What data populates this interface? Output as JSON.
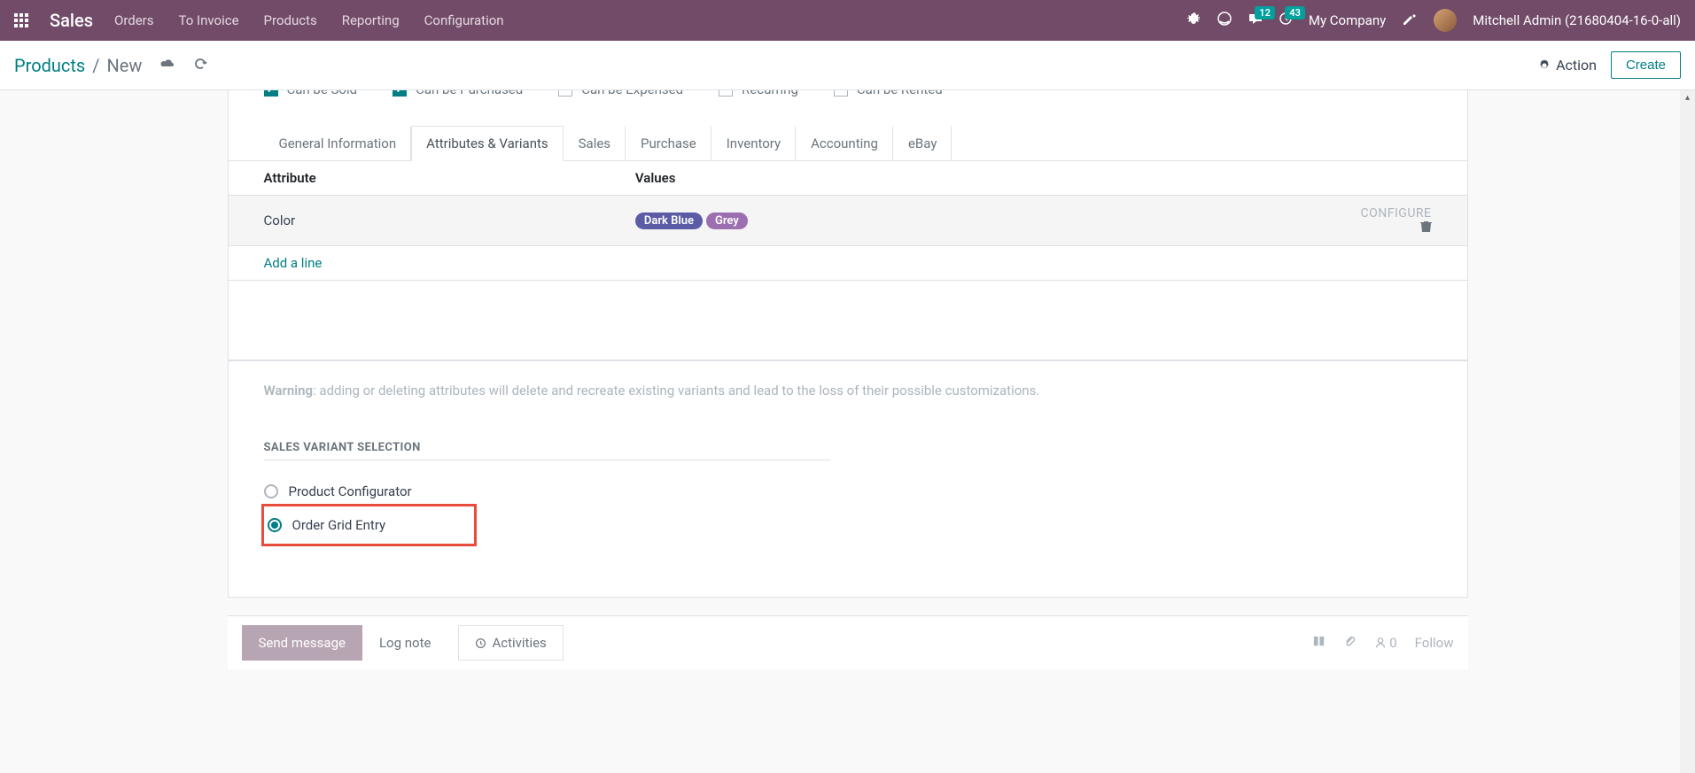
{
  "navbar": {
    "brand": "Sales",
    "menu": [
      "Orders",
      "To Invoice",
      "Products",
      "Reporting",
      "Configuration"
    ],
    "messages_badge": "12",
    "activities_badge": "43",
    "company": "My Company",
    "user": "Mitchell Admin (21680404-16-0-all)"
  },
  "breadcrumb": {
    "parent": "Products",
    "current": "New",
    "action_label": "Action",
    "create_label": "Create"
  },
  "checks": [
    {
      "label": "Can be Sold",
      "checked": true
    },
    {
      "label": "Can be Purchased",
      "checked": true
    },
    {
      "label": "Can be Expensed",
      "checked": false
    },
    {
      "label": "Recurring",
      "checked": false
    },
    {
      "label": "Can be Rented",
      "checked": false
    }
  ],
  "tabs": [
    "General Information",
    "Attributes & Variants",
    "Sales",
    "Purchase",
    "Inventory",
    "Accounting",
    "eBay"
  ],
  "active_tab": "Attributes & Variants",
  "table": {
    "headers": [
      "Attribute",
      "Values"
    ],
    "rows": [
      {
        "attribute": "Color",
        "values": [
          {
            "text": "Dark Blue",
            "cls": "blue"
          },
          {
            "text": "Grey",
            "cls": "grey"
          }
        ]
      }
    ],
    "configure_label": "CONFIGURE",
    "add_line": "Add a line"
  },
  "warning": {
    "strong": "Warning",
    "text": ": adding or deleting attributes will delete and recreate existing variants and lead to the loss of their possible customizations."
  },
  "variant_section": {
    "title": "SALES VARIANT SELECTION",
    "options": [
      {
        "label": "Product Configurator",
        "selected": false,
        "highlight": false
      },
      {
        "label": "Order Grid Entry",
        "selected": true,
        "highlight": true
      }
    ]
  },
  "chatter": {
    "send": "Send message",
    "log": "Log note",
    "activities": "Activities",
    "followers": "0",
    "follow": "Follow"
  }
}
